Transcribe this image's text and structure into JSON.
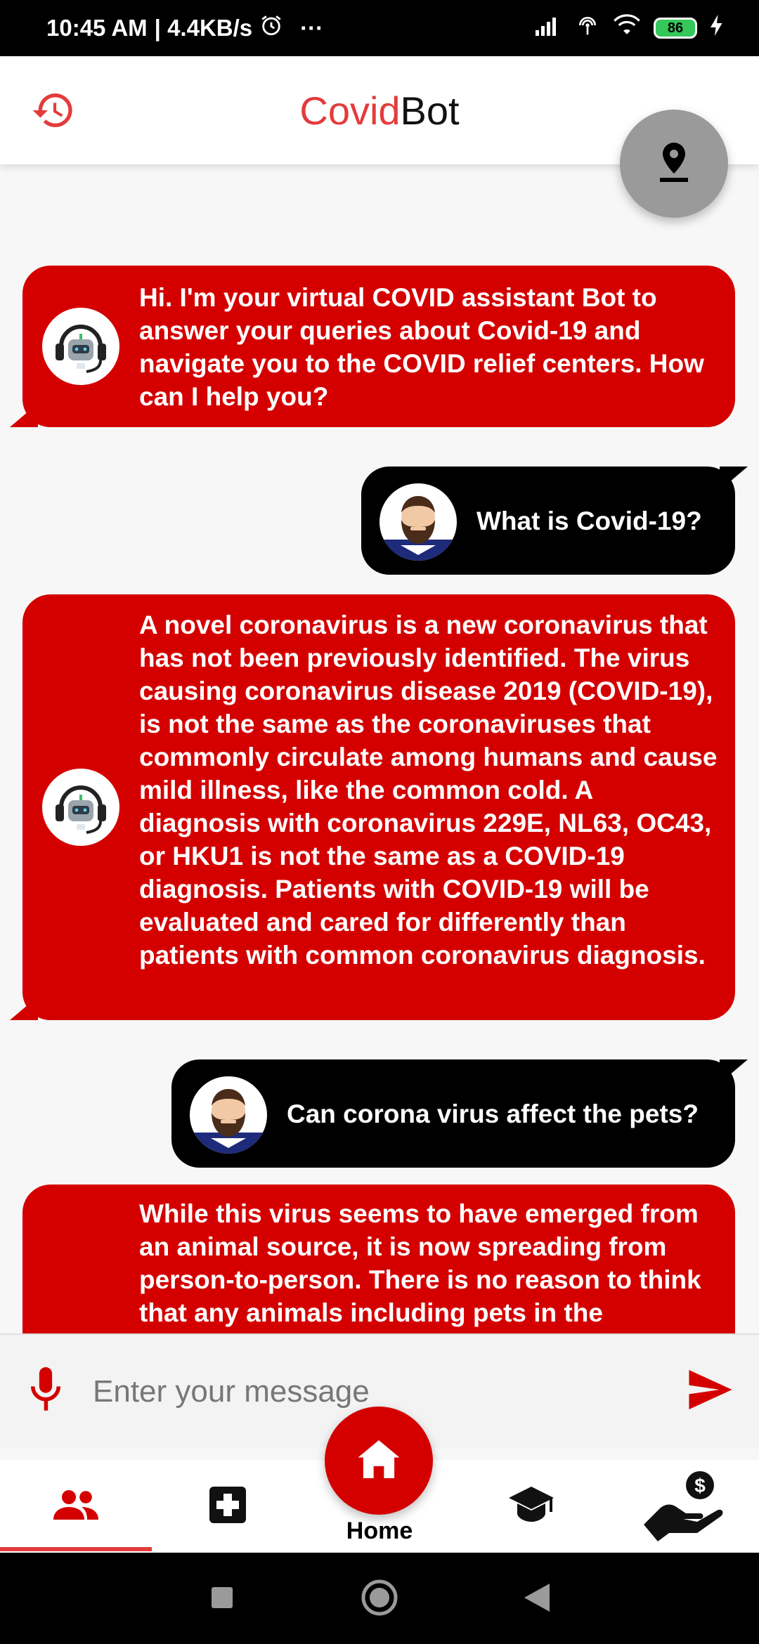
{
  "status_bar": {
    "time": "10:45 AM",
    "speed": "| 4.4KB/s",
    "icons": [
      "alarm-icon",
      "more-dots-icon",
      "signal-icon",
      "hotspot-icon",
      "wifi-icon",
      "battery-icon",
      "charging-icon"
    ],
    "battery": "86",
    "dots": "···"
  },
  "app_bar": {
    "title_part1": "Covid",
    "title_part2": "Bot",
    "history_icon": "history-icon",
    "location_icon": "location-pin-icon",
    "colors": {
      "title_accent": "#e43b3b",
      "bot_bubble": "#d40000",
      "user_bubble": "#000000"
    }
  },
  "chat": {
    "messages": [
      {
        "from": "bot",
        "text": "Hi. I'm your virtual COVID assistant Bot to answer your queries about Covid-19 and navigate you to the COVID relief centers. How can I help you?"
      },
      {
        "from": "user",
        "text": "What is Covid-19?"
      },
      {
        "from": "bot",
        "text": "A novel coronavirus is a new coronavirus that has not been previously identified. The virus causing coronavirus disease 2019 (COVID-19), is not the same as the coronaviruses that commonly circulate among humans and cause mild illness, like the common cold. A diagnosis with coronavirus 229E, NL63, OC43, or HKU1 is not the same as a COVID-19 diagnosis. Patients with COVID-19 will be evaluated and cared for differently than patients with common coronavirus diagnosis."
      },
      {
        "from": "user",
        "text": "Can corona virus affect the pets?"
      },
      {
        "from": "bot",
        "text": "While this virus seems to have emerged from an animal source, it is now spreading from person-to-person. There is no reason to think that any animals including pets in the"
      }
    ]
  },
  "input_bar": {
    "placeholder": "Enter your message",
    "mic_icon": "mic-icon",
    "send_icon": "send-icon"
  },
  "bottom_nav": {
    "items": [
      {
        "icon": "people-icon",
        "active": true
      },
      {
        "icon": "medical-cross-icon",
        "active": false
      },
      {
        "icon": "home-icon",
        "label": "Home",
        "active": false
      },
      {
        "icon": "graduation-cap-icon",
        "active": false
      },
      {
        "icon": "donate-hand-icon",
        "active": false
      }
    ]
  },
  "system_nav": [
    "recents-square-icon",
    "home-circle-icon",
    "back-triangle-icon"
  ]
}
